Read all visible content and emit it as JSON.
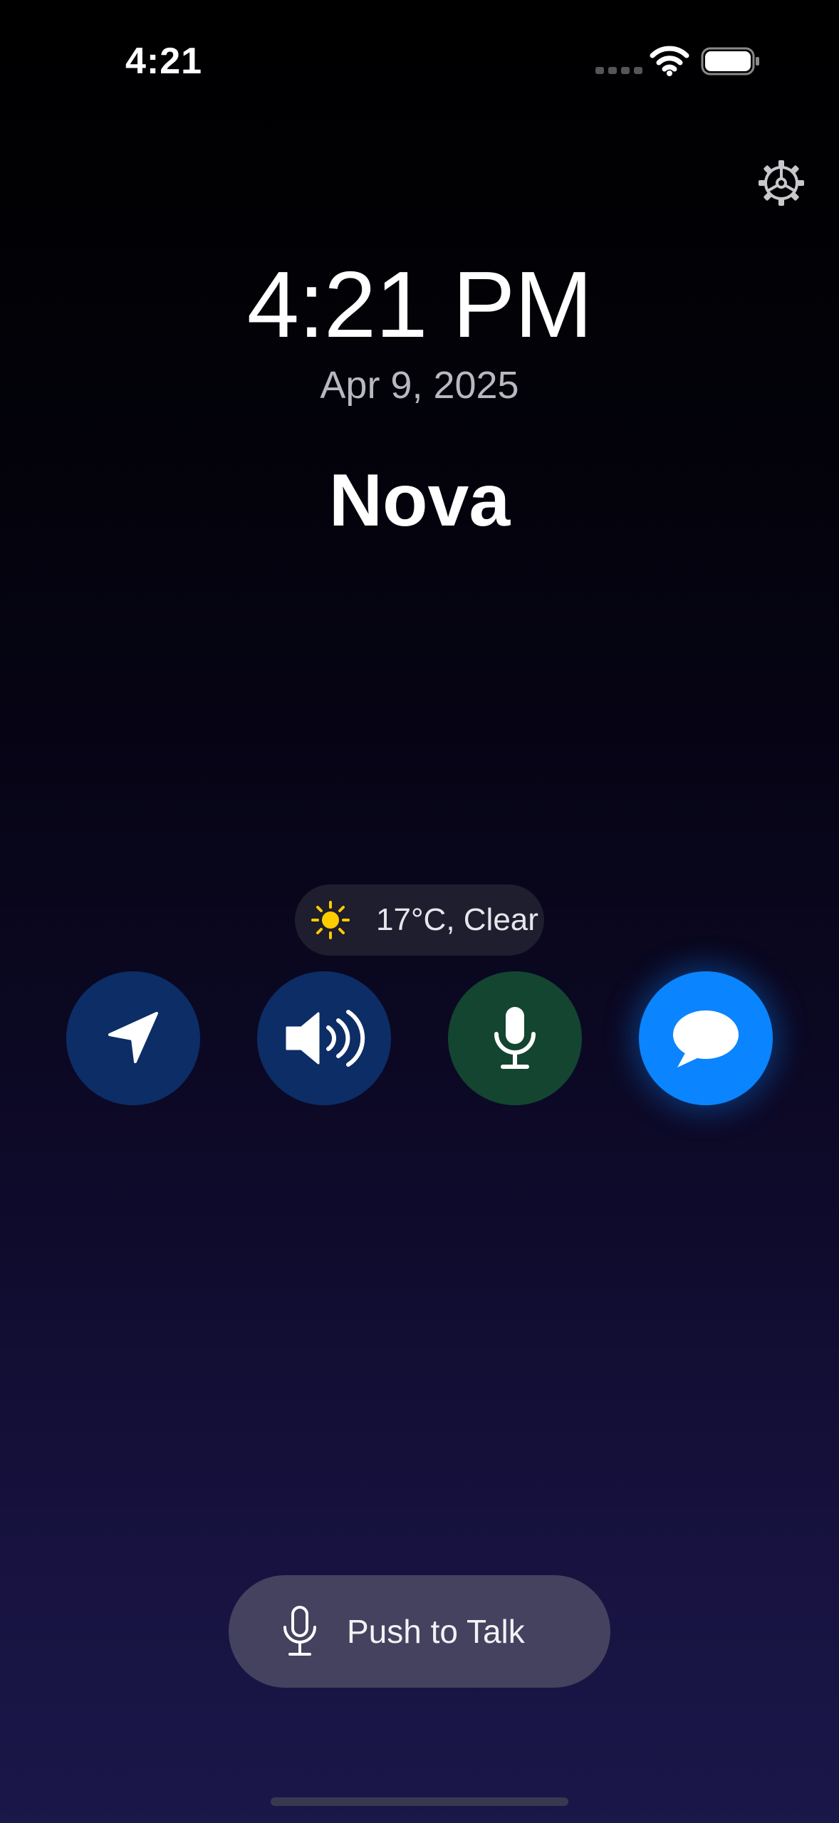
{
  "status_bar": {
    "time": "4:21"
  },
  "main": {
    "clock": "4:21 PM",
    "date": "Apr 9, 2025",
    "assistant_name": "Nova"
  },
  "weather": {
    "text": "17°C, Clear",
    "icon": "sun-icon"
  },
  "actions": [
    {
      "name": "navigation",
      "icon": "navigation-arrow-icon",
      "color": "#0c2d66"
    },
    {
      "name": "volume",
      "icon": "speaker-wave-icon",
      "color": "#0c2d66"
    },
    {
      "name": "voice",
      "icon": "microphone-icon",
      "color": "#134531"
    },
    {
      "name": "chat",
      "icon": "chat-bubble-icon",
      "color": "#0a84ff"
    }
  ],
  "push_to_talk": {
    "label": "Push to Talk",
    "icon": "microphone-icon"
  },
  "colors": {
    "accent": "#0a84ff",
    "sun": "#ffcc00",
    "pill_bg": "#1e1e2e",
    "ptt_bg": "#44425e"
  }
}
